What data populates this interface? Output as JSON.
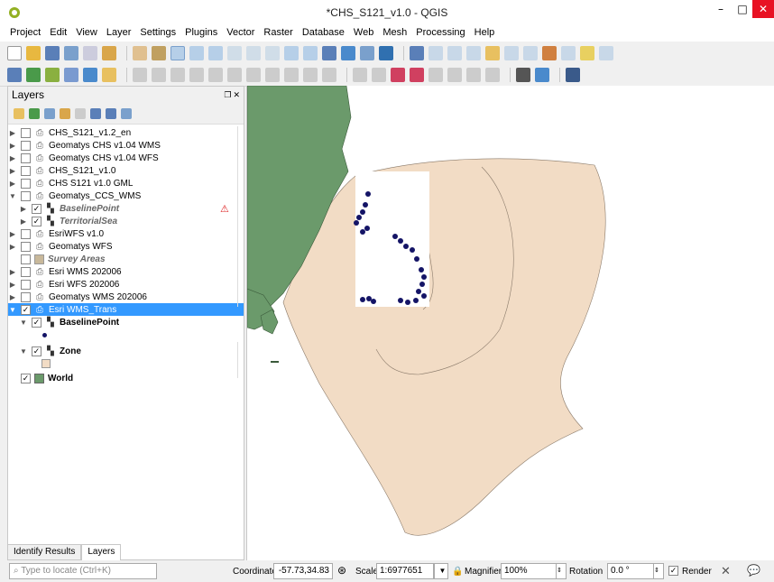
{
  "window": {
    "title": "*CHS_S121_v1.0 - QGIS",
    "min": "–",
    "max": "□",
    "close": "✕"
  },
  "menu": [
    "Project",
    "Edit",
    "View",
    "Layer",
    "Settings",
    "Plugins",
    "Vector",
    "Raster",
    "Database",
    "Web",
    "Mesh",
    "Processing",
    "Help"
  ],
  "layers_panel": {
    "title": "Layers",
    "tree": [
      {
        "label": "CHS_S121_v1.2_en"
      },
      {
        "label": "Geomatys CHS v1.04 WMS"
      },
      {
        "label": "Geomatys CHS v1.04 WFS"
      },
      {
        "label": "CHS_S121_v1.0"
      },
      {
        "label": "CHS S121 v1.0 GML"
      },
      {
        "label": "Geomatys_CCS_WMS"
      },
      {
        "label": "BaselinePoint"
      },
      {
        "label": "TerritorialSea"
      },
      {
        "label": "EsriWFS v1.0"
      },
      {
        "label": "Geomatys WFS"
      },
      {
        "label": "Survey Areas"
      },
      {
        "label": "Esri WMS 202006"
      },
      {
        "label": "Esri WFS 202006"
      },
      {
        "label": "Geomatys WMS 202006"
      },
      {
        "label": "Esri WMS_Trans"
      },
      {
        "label": "BaselinePoint"
      },
      {
        "label": "Zone"
      },
      {
        "label": "World"
      }
    ]
  },
  "bottom_tabs": [
    "Identify Results",
    "Layers"
  ],
  "status": {
    "locate_placeholder": "Type to locate (Ctrl+K)",
    "coordinate_label": "Coordinate",
    "coordinate_value": "-57.73,34.83",
    "scale_label": "Scale",
    "scale_value": "1:6977651",
    "magnifier_label": "Magnifier",
    "magnifier_value": "100%",
    "rotation_label": "Rotation",
    "rotation_value": "0.0 °",
    "render_label": "Render"
  },
  "colors": {
    "land": "#6b9a6b",
    "zone": "#f2dcc5",
    "points": "#141466",
    "selection": "#3399ff"
  }
}
